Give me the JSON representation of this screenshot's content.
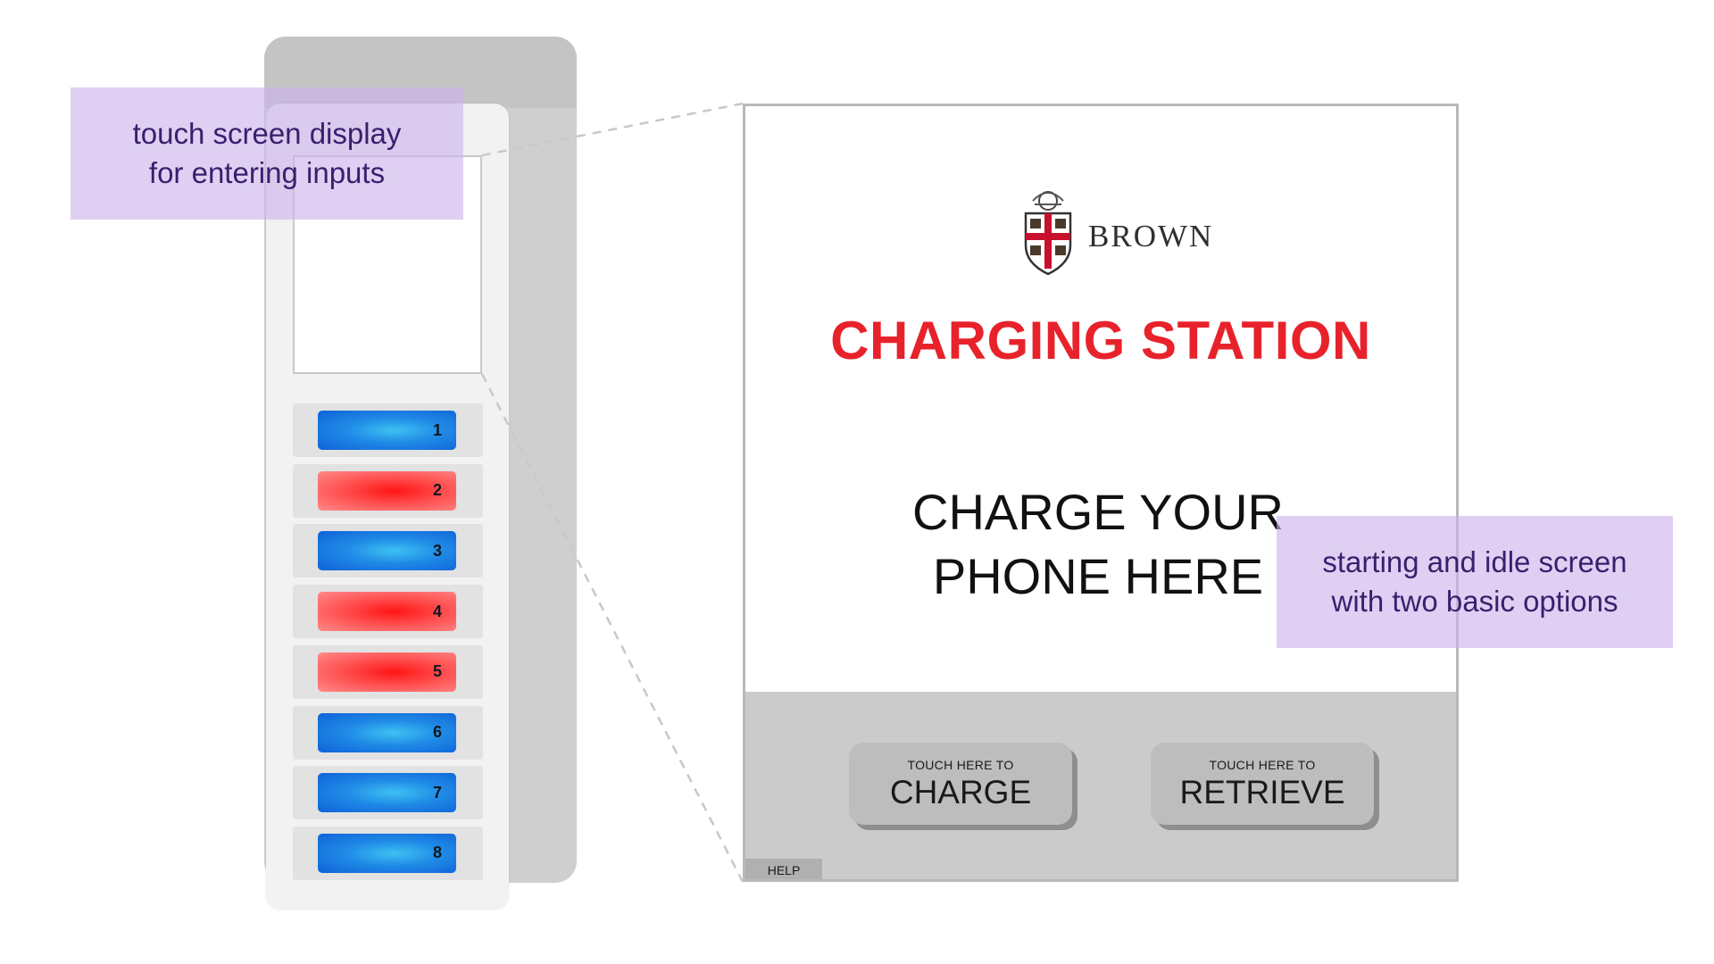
{
  "annotations": {
    "kiosk_note": [
      "touch screen display",
      "for entering inputs"
    ],
    "screen_note": [
      "starting and idle screen",
      "with two basic options"
    ]
  },
  "kiosk": {
    "slots": [
      {
        "label": "1",
        "state": "blue"
      },
      {
        "label": "2",
        "state": "red"
      },
      {
        "label": "3",
        "state": "blue"
      },
      {
        "label": "4",
        "state": "red"
      },
      {
        "label": "5",
        "state": "red"
      },
      {
        "label": "6",
        "state": "blue"
      },
      {
        "label": "7",
        "state": "blue"
      },
      {
        "label": "8",
        "state": "blue"
      }
    ]
  },
  "screen": {
    "brand": "BROWN",
    "title": "CHARGING STATION",
    "headline": [
      "CHARGE YOUR",
      "PHONE HERE"
    ],
    "buttons": {
      "charge": {
        "sub": "TOUCH HERE TO",
        "main": "CHARGE"
      },
      "retrieve": {
        "sub": "TOUCH HERE TO",
        "main": "RETRIEVE"
      }
    },
    "help": "HELP"
  },
  "colors": {
    "title_red": "#e8222b",
    "slot_blue": "#1f8ae6",
    "slot_red": "#ff3030",
    "annotation_fill": "#ccb3ec",
    "annotation_text": "#3a1f6e"
  }
}
